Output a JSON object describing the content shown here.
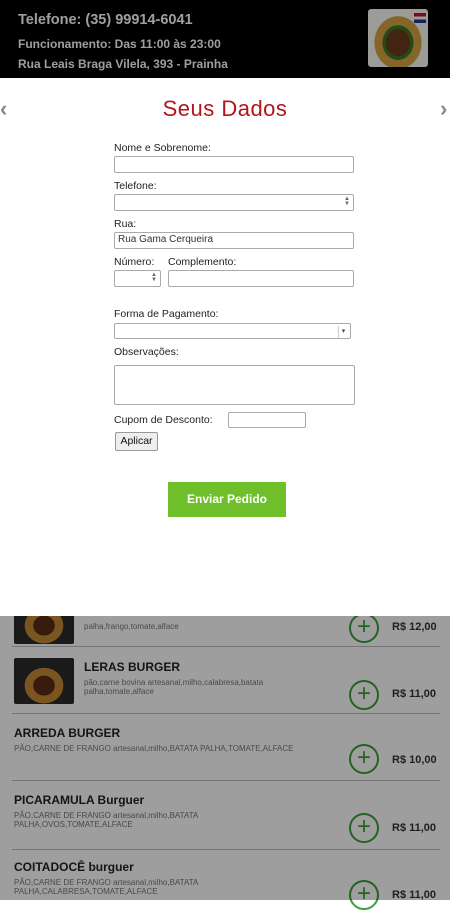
{
  "header": {
    "phone": "Telefone: (35) 99914-6041",
    "hours": "Funcionamento: Das 11:00 às 23:00",
    "address": "Rua Leais Braga Vilela, 393 - Prainha"
  },
  "modal": {
    "title": "Seus Dados",
    "prev_icon": "‹",
    "next_icon": "›",
    "fields": {
      "name_label": "Nome e Sobrenome:",
      "name_value": "",
      "phone_label": "Telefone:",
      "phone_value": "",
      "street_label": "Rua:",
      "street_value": "Rua Gama Cerqueira",
      "number_label": "Número:",
      "number_value": "",
      "complement_label": "Complemento:",
      "complement_value": "",
      "payment_label": "Forma de Pagamento:",
      "payment_value": "",
      "notes_label": "Observações:",
      "notes_value": "",
      "coupon_label": "Cupom de Desconto:",
      "coupon_value": ""
    },
    "apply_button": "Aplicar",
    "submit_button": "Enviar Pedido"
  },
  "menu": {
    "add_icon": "+",
    "items": [
      {
        "name": "",
        "desc": "palha,frango,tomate,alface",
        "price": "R$ 12,00",
        "has_image": true
      },
      {
        "name": "LERAS BURGER",
        "desc": "pão,carne bovina artesanal,milho,calabresa,batata palha,tomate,alface",
        "price": "R$ 11,00",
        "has_image": true
      },
      {
        "name": "ARREDA BURGER",
        "desc": "PÃO,CARNE DE FRANGO artesanal,milho,BATATA PALHA,TOMATE,ALFACE",
        "price": "R$ 10,00",
        "has_image": false
      },
      {
        "name": "PICARAMULA Burguer",
        "desc": "PÃO,CARNE DE FRANGO artesanal,milho,BATATA PALHA,OVOS,TOMATE,ALFACE",
        "price": "R$ 11,00",
        "has_image": false
      },
      {
        "name": "COITADOCÊ burguer",
        "desc": "PÃO,CARNE DE FRANGO artesanal,milho,BATATA PALHA,CALABRESA,TOMATE,ALFACE",
        "price": "R$ 11,00",
        "has_image": false
      }
    ]
  }
}
